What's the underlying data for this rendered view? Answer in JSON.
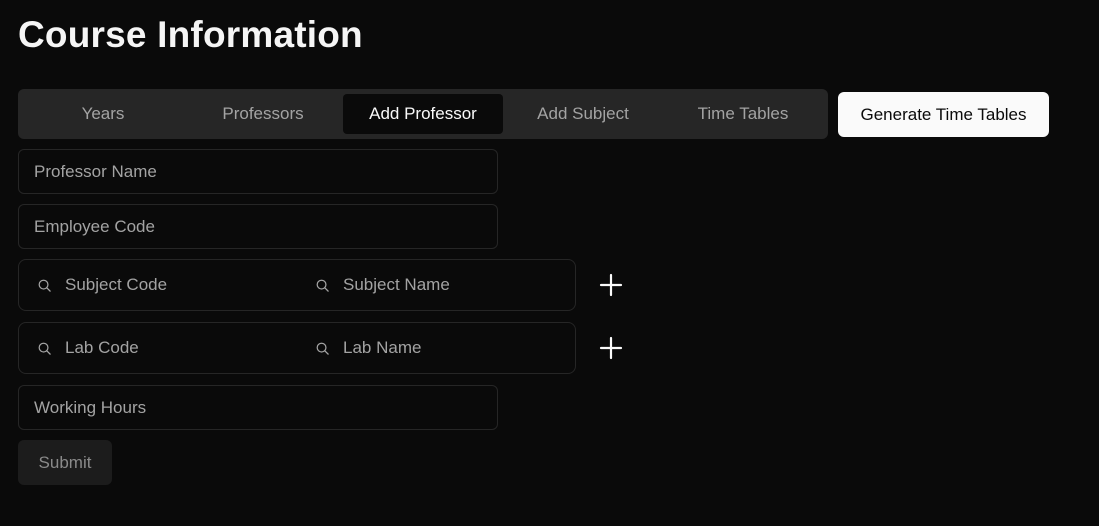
{
  "page": {
    "title": "Course Information"
  },
  "tabs": [
    {
      "label": "Years",
      "active": false
    },
    {
      "label": "Professors",
      "active": false
    },
    {
      "label": "Add Professor",
      "active": true
    },
    {
      "label": "Add Subject",
      "active": false
    },
    {
      "label": "Time Tables",
      "active": false
    }
  ],
  "actions": {
    "generate_label": "Generate Time Tables"
  },
  "form": {
    "professor_name": {
      "value": "",
      "placeholder": "Professor Name"
    },
    "employee_code": {
      "value": "",
      "placeholder": "Employee Code"
    },
    "subject_row": {
      "code_placeholder": "Subject Code",
      "name_placeholder": "Subject Name",
      "search_icon": "search-icon",
      "add_icon": "plus-icon"
    },
    "lab_row": {
      "code_placeholder": "Lab Code",
      "name_placeholder": "Lab Name",
      "search_icon": "search-icon",
      "add_icon": "plus-icon"
    },
    "working_hours": {
      "value": "",
      "placeholder": "Working Hours"
    },
    "submit_label": "Submit"
  },
  "colors": {
    "background": "#0a0a0a",
    "tab_bar": "#262626",
    "active_tab": "#0a0a0a",
    "primary_button": "#fafafa",
    "muted_text": "#a3a3a3",
    "border": "#262626"
  }
}
